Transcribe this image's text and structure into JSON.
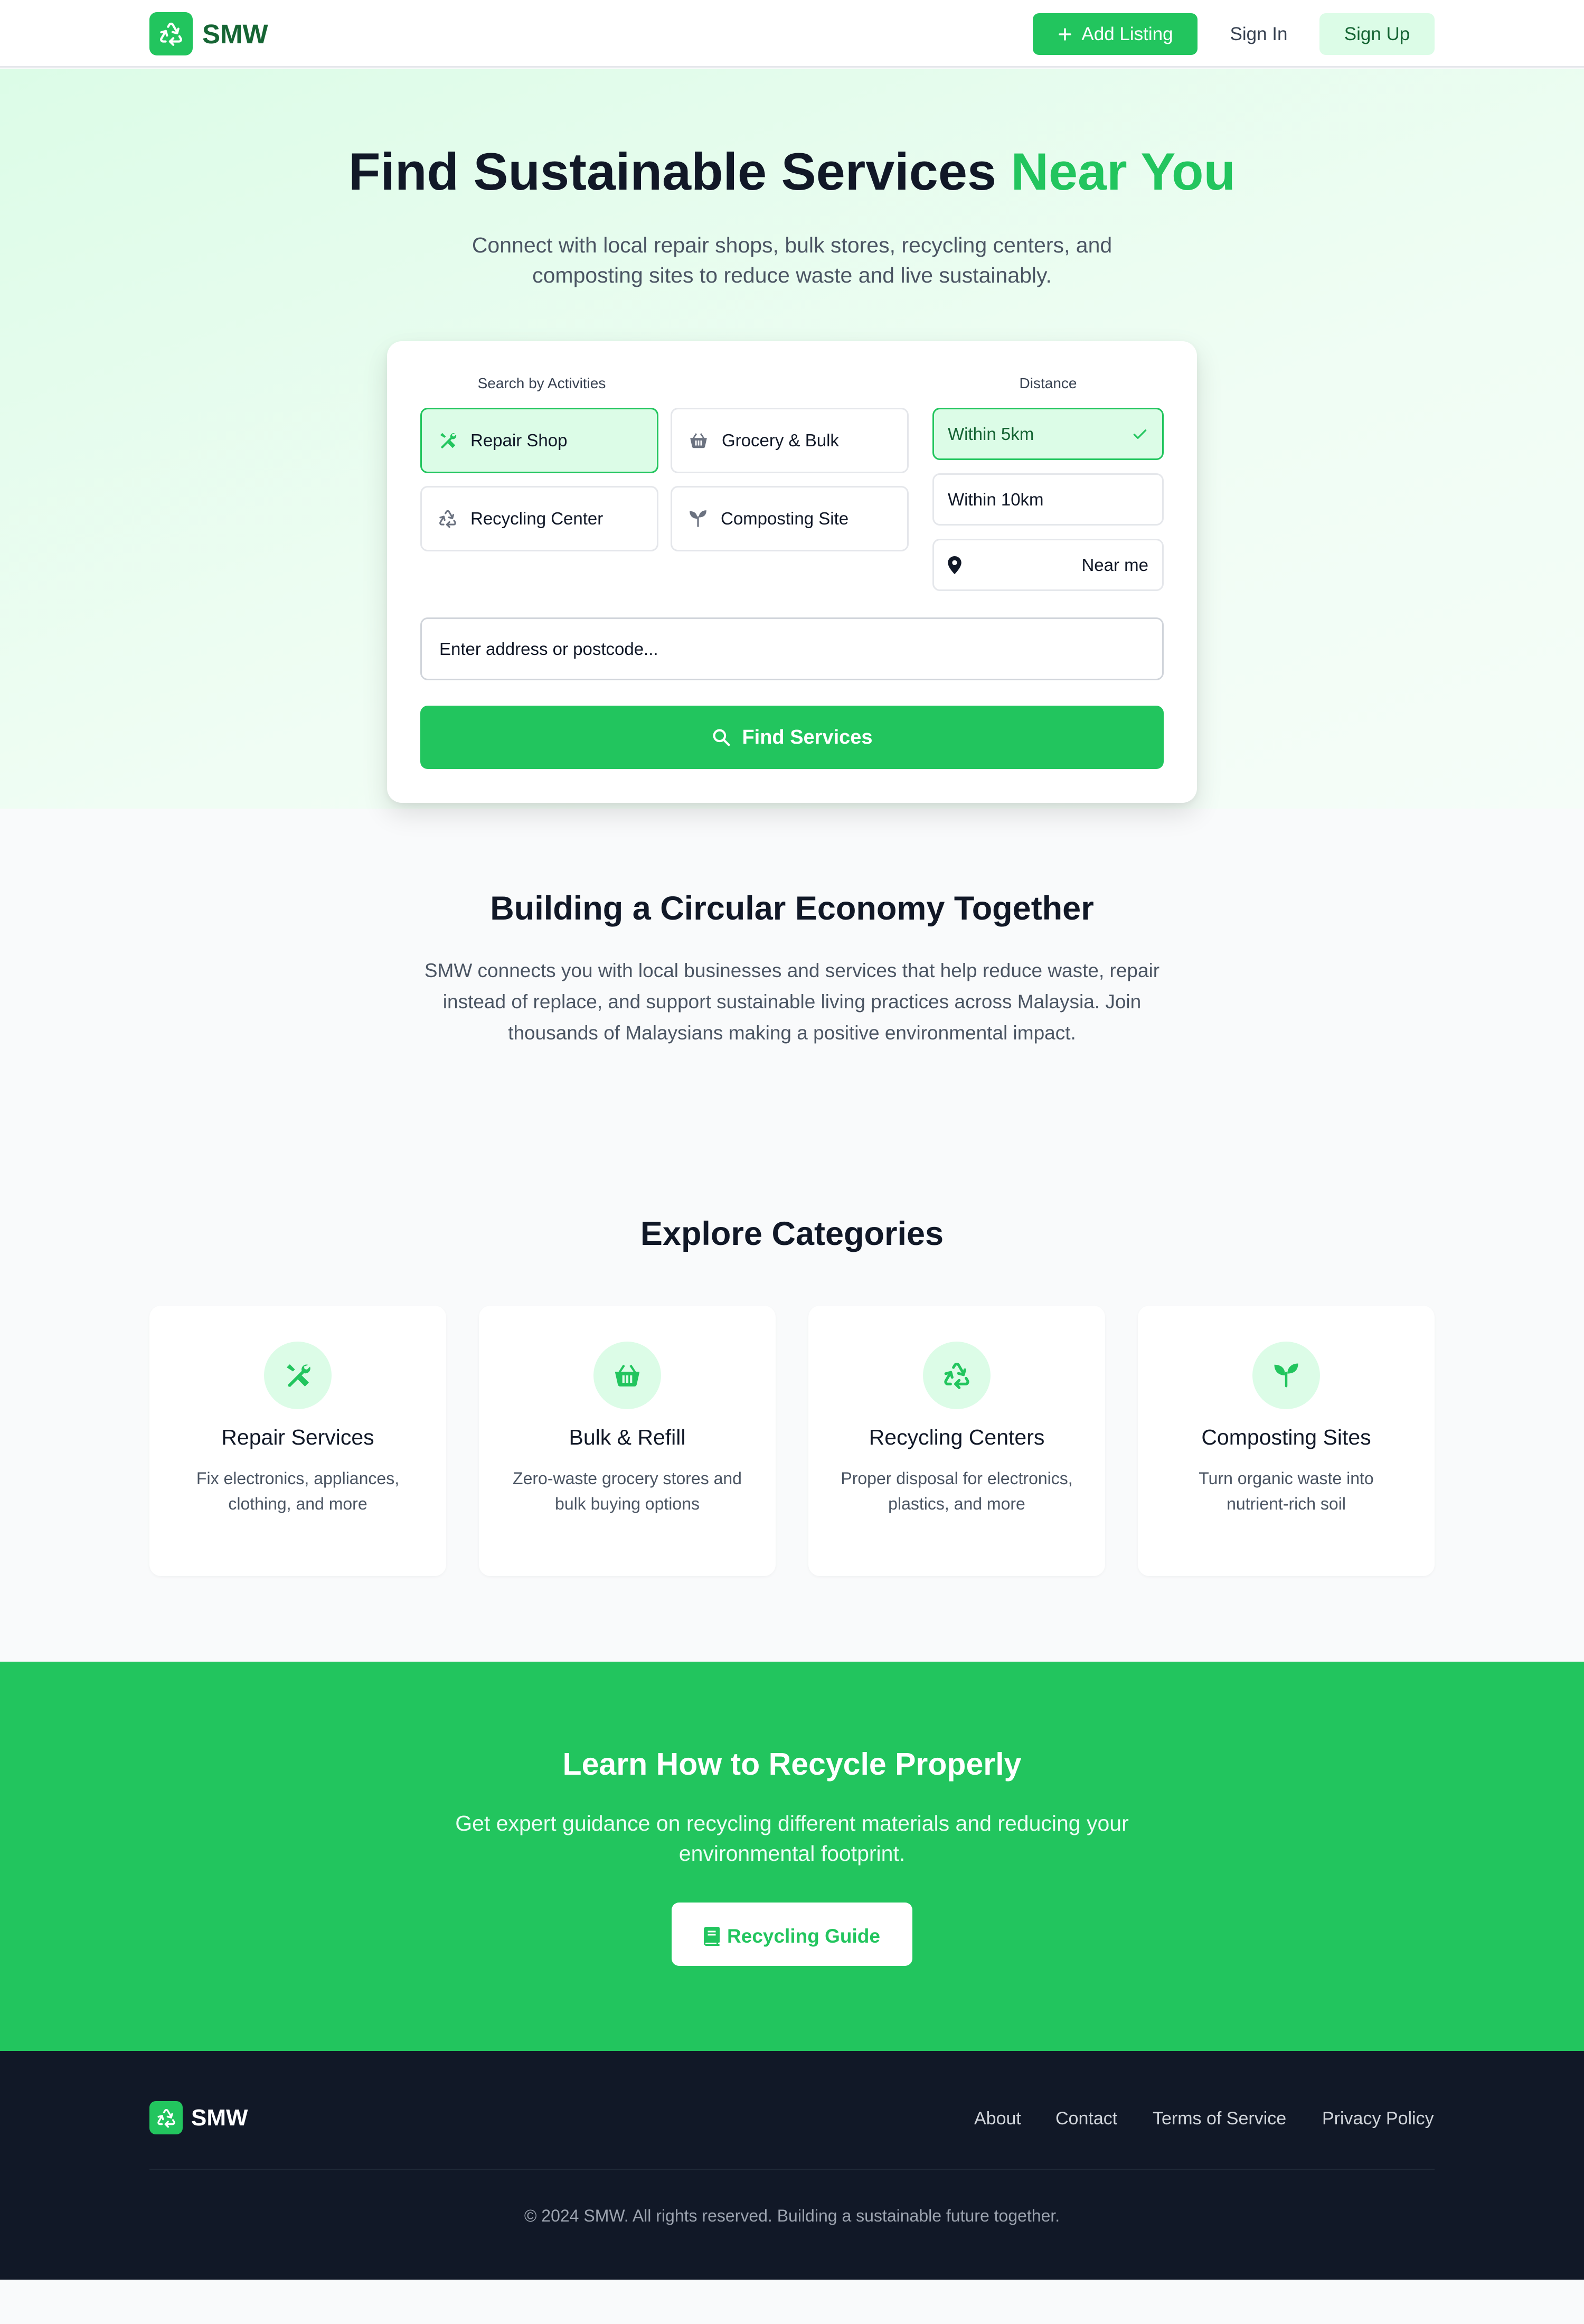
{
  "colors": {
    "accent": "#22c55e",
    "accent_dark": "#166534",
    "accent_light": "#dcfce7",
    "footer_bg": "#111827"
  },
  "header": {
    "logo_text": "SMW",
    "logo_icon": "recycle-icon",
    "add_listing_label": "Add Listing",
    "sign_in_label": "Sign In",
    "sign_up_label": "Sign Up"
  },
  "hero": {
    "title_main": "Find Sustainable Services ",
    "title_accent": "Near You",
    "subtitle": "Connect with local repair shops, bulk stores, recycling centers, and composting sites to reduce waste and live sustainably."
  },
  "search": {
    "activities_label": "Search by Activities",
    "activities": [
      {
        "label": "Repair Shop",
        "icon": "tools-icon",
        "selected": true
      },
      {
        "label": "Grocery & Bulk",
        "icon": "basket-icon",
        "selected": false
      },
      {
        "label": "Recycling Center",
        "icon": "recycle-icon",
        "selected": false
      },
      {
        "label": "Composting Site",
        "icon": "seedling-icon",
        "selected": false
      }
    ],
    "distance_label": "Distance",
    "distances": [
      {
        "label": "Within 5km",
        "selected": true
      },
      {
        "label": "Within 10km",
        "selected": false
      },
      {
        "label": "Near me",
        "icon": "map-pin-icon",
        "selected": false
      }
    ],
    "address_placeholder": "Enter address or postcode...",
    "find_label": "Find Services"
  },
  "circular": {
    "title": "Building a Circular Economy Together",
    "text": "SMW connects you with local businesses and services that help reduce waste, repair instead of replace, and support sustainable living practices across Malaysia. Join thousands of Malaysians making a positive environmental impact."
  },
  "categories": {
    "title": "Explore Categories",
    "items": [
      {
        "name": "Repair Services",
        "desc": "Fix electronics, appliances, clothing, and more",
        "icon": "tools-icon"
      },
      {
        "name": "Bulk & Refill",
        "desc": "Zero-waste grocery stores and bulk buying options",
        "icon": "basket-icon"
      },
      {
        "name": "Recycling Centers",
        "desc": "Proper disposal for electronics, plastics, and more",
        "icon": "recycle-icon"
      },
      {
        "name": "Composting Sites",
        "desc": "Turn organic waste into nutrient-rich soil",
        "icon": "seedling-icon"
      }
    ]
  },
  "learn": {
    "title": "Learn How to Recycle Properly",
    "subtitle": "Get expert guidance on recycling different materials and reducing your environmental footprint.",
    "button_label": "Recycling Guide",
    "button_icon": "book-icon"
  },
  "footer": {
    "logo_text": "SMW",
    "links": [
      "About",
      "Contact",
      "Terms of Service",
      "Privacy Policy"
    ],
    "copyright": "© 2024 SMW. All rights reserved. Building a sustainable future together."
  }
}
